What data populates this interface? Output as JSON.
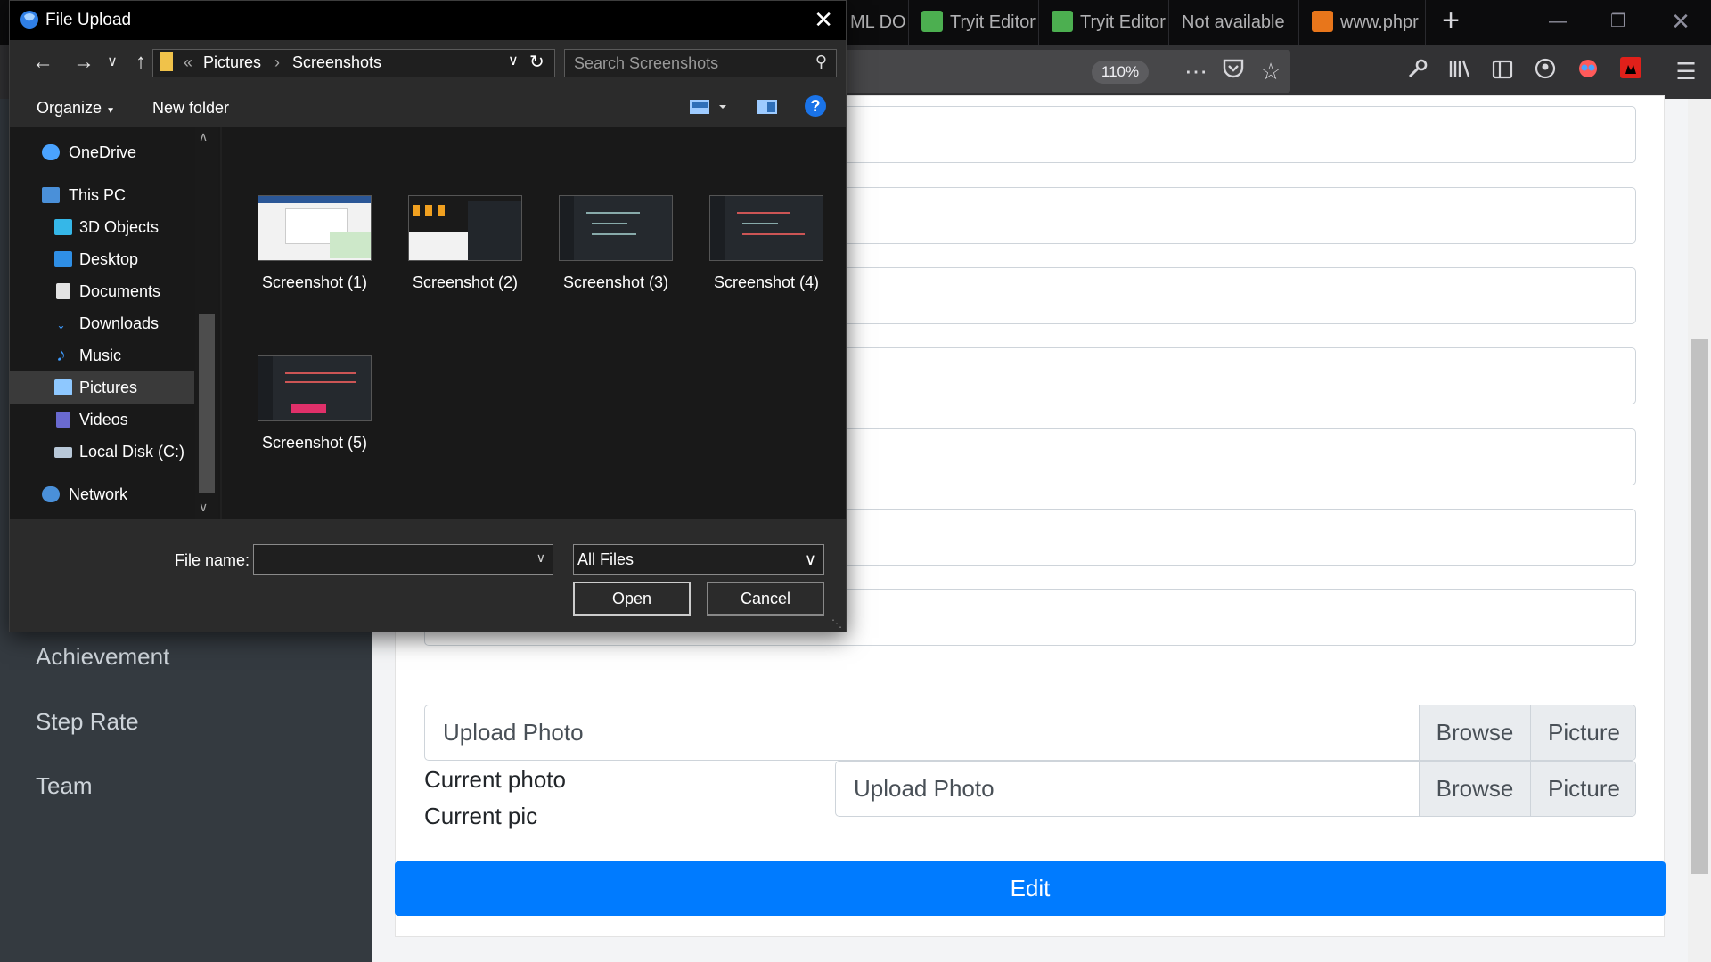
{
  "browser": {
    "tabs": [
      {
        "label": "ML DO"
      },
      {
        "label": "Tryit Editor"
      },
      {
        "label": "Tryit Editor"
      },
      {
        "label": "Not available"
      },
      {
        "label": "www.phpr"
      }
    ],
    "new_tab": "+",
    "zoom": "110%",
    "colors": {
      "chrome": "#0c0c0d",
      "toolbar": "#323234"
    }
  },
  "sidebar": {
    "items": [
      {
        "label": "Achievement"
      },
      {
        "label": "Step Rate"
      },
      {
        "label": "Team"
      }
    ]
  },
  "form": {
    "upload1": {
      "placeholder": "Upload Photo",
      "browse": "Browse",
      "picture": "Picture"
    },
    "upload2": {
      "placeholder": "Upload Photo",
      "browse": "Browse",
      "picture": "Picture"
    },
    "current_photo": "Current photo",
    "current_pic": "Current pic",
    "edit_label": "Edit",
    "accent": "#007bff"
  },
  "dialog": {
    "title": "File Upload",
    "breadcrumb": {
      "sep": "«",
      "root": "Pictures",
      "arrow": "›",
      "folder": "Screenshots"
    },
    "search_placeholder": "Search Screenshots",
    "toolbar": {
      "organize": "Organize",
      "new_folder": "New folder",
      "help": "?"
    },
    "nav": [
      {
        "label": "OneDrive",
        "icon": "cloud-icon"
      },
      {
        "label": "This PC",
        "icon": "computer-icon"
      },
      {
        "label": "3D Objects",
        "icon": "cube-icon"
      },
      {
        "label": "Desktop",
        "icon": "desktop-icon"
      },
      {
        "label": "Documents",
        "icon": "document-icon"
      },
      {
        "label": "Downloads",
        "icon": "download-icon"
      },
      {
        "label": "Music",
        "icon": "music-icon"
      },
      {
        "label": "Pictures",
        "icon": "pictures-icon"
      },
      {
        "label": "Videos",
        "icon": "video-icon"
      },
      {
        "label": "Local Disk (C:)",
        "icon": "disk-icon"
      },
      {
        "label": "Network",
        "icon": "network-icon"
      }
    ],
    "files": [
      {
        "name": "Screenshot (1)"
      },
      {
        "name": "Screenshot (2)"
      },
      {
        "name": "Screenshot (3)"
      },
      {
        "name": "Screenshot (4)"
      },
      {
        "name": "Screenshot (5)"
      }
    ],
    "file_name_label": "File name:",
    "file_name_value": "",
    "file_type": "All Files",
    "open": "Open",
    "cancel": "Cancel"
  }
}
